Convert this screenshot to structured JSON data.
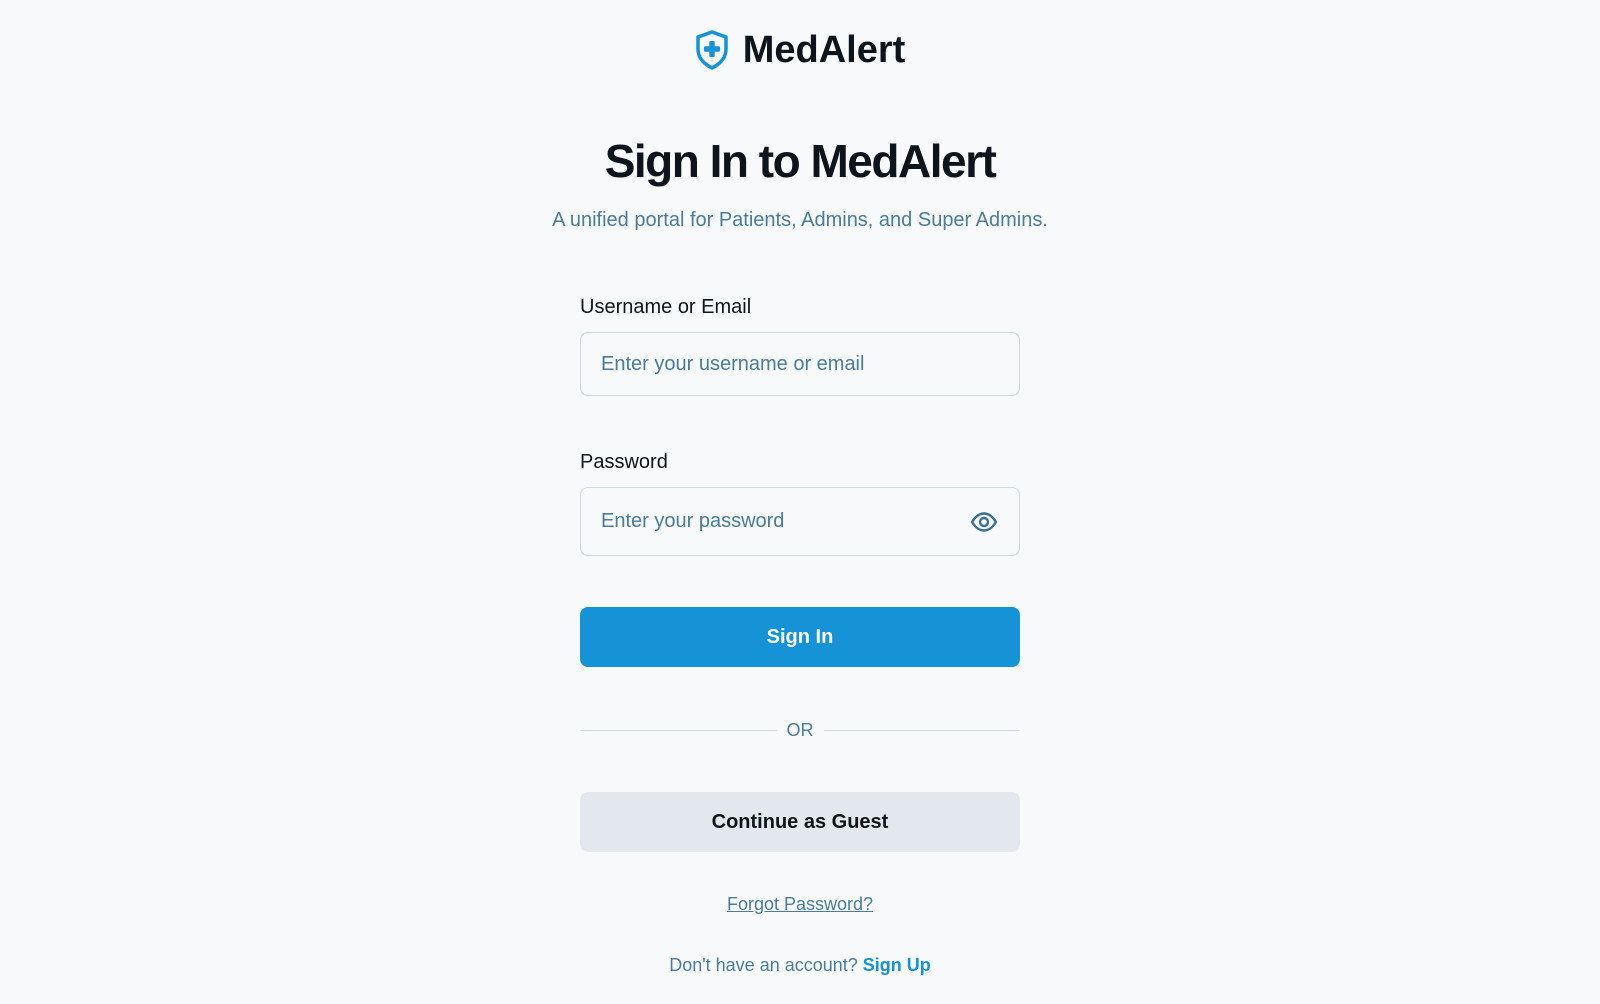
{
  "brand": {
    "name": "MedAlert",
    "icon": "shield-plus-icon",
    "accent_color": "#1593d6"
  },
  "header": {
    "title": "Sign In to MedAlert",
    "subtitle": "A unified portal for Patients, Admins, and Super Admins."
  },
  "form": {
    "username": {
      "label": "Username or Email",
      "placeholder": "Enter your username or email",
      "value": ""
    },
    "password": {
      "label": "Password",
      "placeholder": "Enter your password",
      "value": "",
      "toggle_icon": "eye-icon"
    },
    "sign_in_label": "Sign In",
    "divider_text": "OR",
    "guest_label": "Continue as Guest",
    "forgot_label": "Forgot Password?",
    "signup_prompt": "Don't have an account?",
    "signup_label": "Sign Up"
  },
  "colors": {
    "primary": "#1593d6",
    "muted_text": "#4a7c9b",
    "secondary_button": "#e3e8ef",
    "background": "#f7f9fb"
  }
}
